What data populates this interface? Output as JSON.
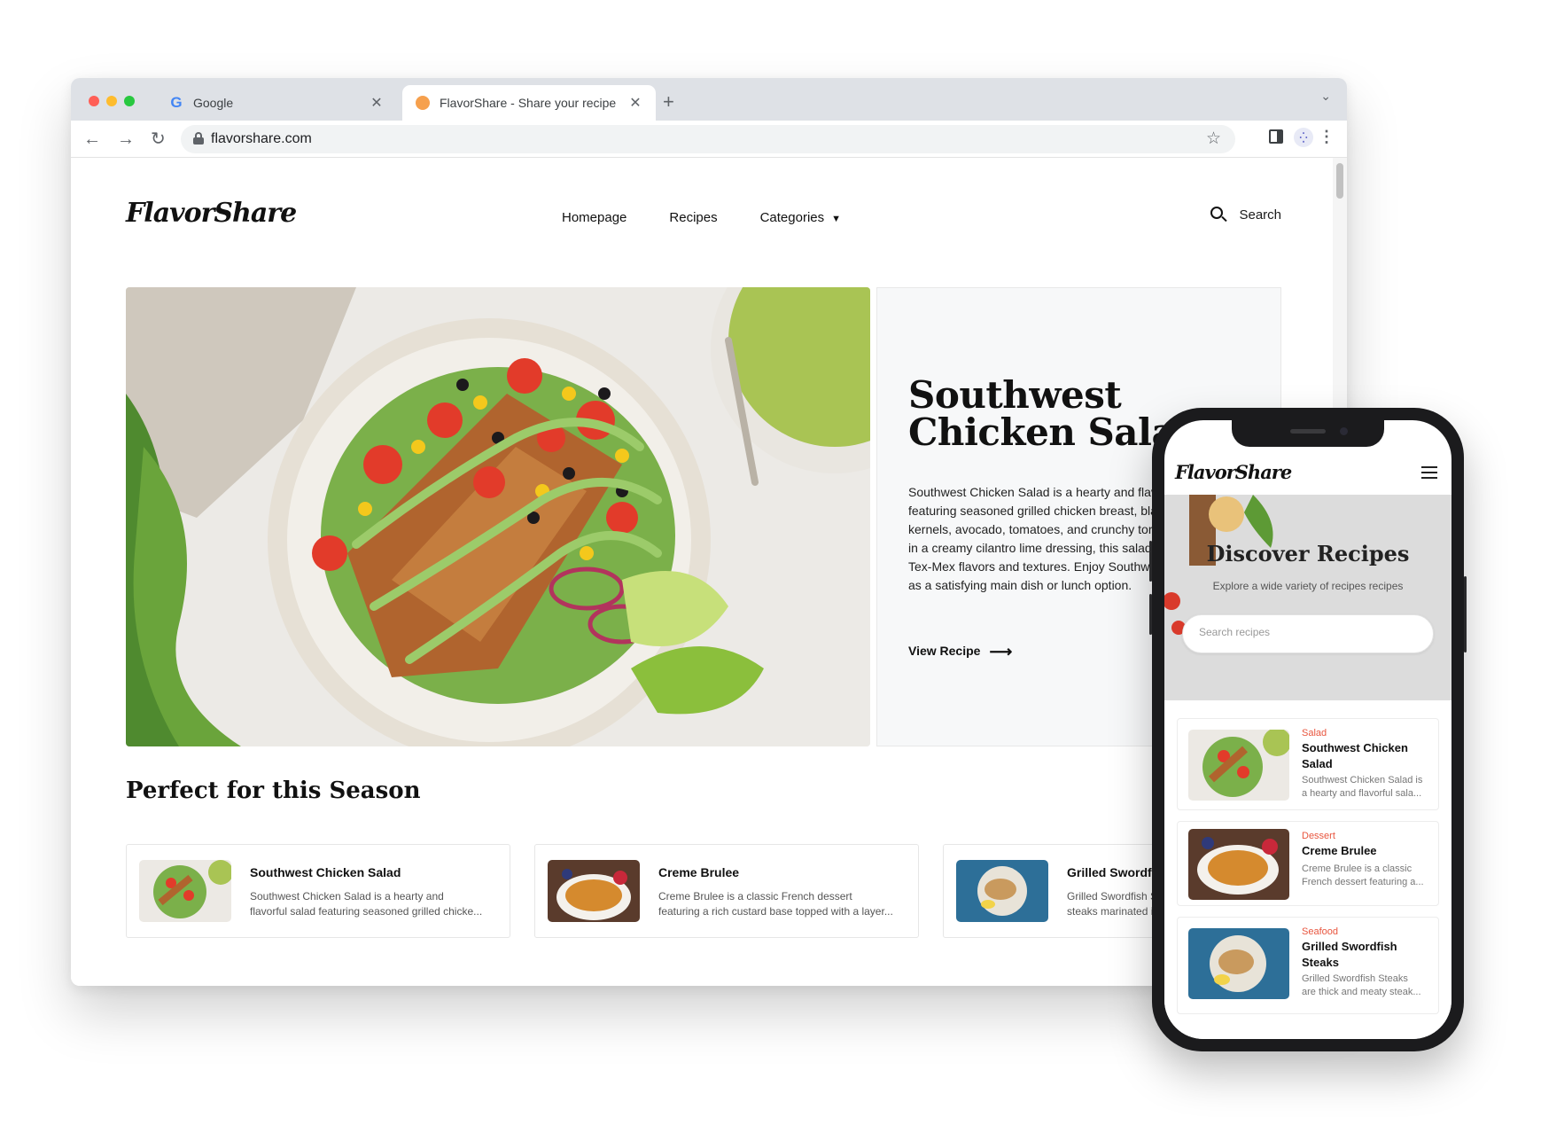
{
  "browser": {
    "tabs": [
      {
        "title": "Google",
        "favicon": "google-icon"
      },
      {
        "title": "FlavorShare - Share your recipe",
        "favicon": "flavorshare-icon",
        "active": true
      }
    ],
    "url": "flavorshare.com"
  },
  "site": {
    "logo": "FlavorShare",
    "nav": {
      "homepage": "Homepage",
      "recipes": "Recipes",
      "categories": "Categories"
    },
    "search_label": "Search",
    "hero": {
      "title": "Southwest Chicken Salad",
      "description": "Southwest Chicken Salad is a hearty and flavorful salad featuring seasoned grilled chicken breast, black beans, corn kernels, avocado, tomatoes, and crunchy tortilla strips. Tossed in a creamy cilantro lime dressing, this salad is bursting with Tex-Mex flavors and textures. Enjoy Southwest Chicken Salad as a satisfying main dish or lunch option.",
      "cta": "View Recipe"
    },
    "section_title": "Perfect for this Season",
    "cards": [
      {
        "title": "Southwest Chicken Salad",
        "desc1": "Southwest Chicken Salad is a hearty and",
        "desc2": "flavorful salad featuring seasoned grilled chicke..."
      },
      {
        "title": "Creme Brulee",
        "desc1": "Creme Brulee is a classic French dessert",
        "desc2": "featuring a rich custard base topped with a layer..."
      },
      {
        "title": "Grilled Swordfish Steaks",
        "desc1": "Grilled Swordfish Steaks are thick and meaty",
        "desc2": "steaks marinated in a zesty herb marinade..."
      }
    ]
  },
  "mobile": {
    "logo": "FlavorShare",
    "hero_title": "Discover Recipes",
    "hero_subtitle": "Explore a wide variety of recipes recipes",
    "search_placeholder": "Search recipes",
    "cards": [
      {
        "category": "Salad",
        "title": "Southwest Chicken Salad",
        "desc1": "Southwest Chicken Salad is",
        "desc2": "a hearty and flavorful sala..."
      },
      {
        "category": "Dessert",
        "title": "Creme Brulee",
        "desc1": "Creme Brulee is a classic",
        "desc2": "French dessert featuring a..."
      },
      {
        "category": "Seafood",
        "title": "Grilled Swordfish Steaks",
        "desc1": "Grilled Swordfish Steaks",
        "desc2": "are thick and meaty steak..."
      }
    ]
  },
  "colors": {
    "category_accent": "#e8553e",
    "tab_bar": "#dee1e6",
    "hero_card_bg": "#f7f8f9"
  }
}
